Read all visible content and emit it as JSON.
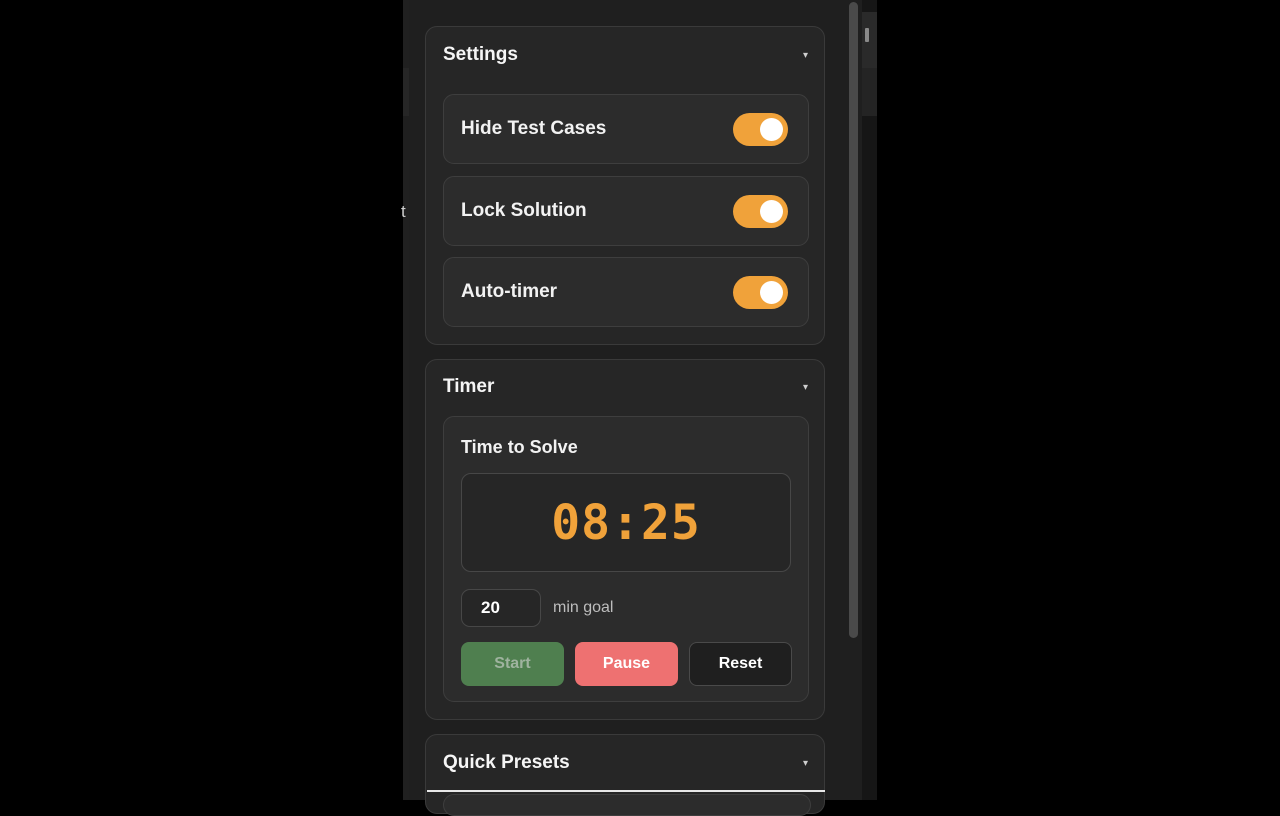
{
  "background": {
    "left_fragment": "t"
  },
  "settings": {
    "title": "Settings",
    "caret": "▾",
    "items": [
      {
        "label": "Hide Test Cases",
        "enabled": true
      },
      {
        "label": "Lock Solution",
        "enabled": true
      },
      {
        "label": "Auto-timer",
        "enabled": true
      }
    ]
  },
  "timer": {
    "title": "Timer",
    "caret": "▾",
    "subtitle": "Time to Solve",
    "display": "08:25",
    "goal_value": "20",
    "goal_label": "min goal",
    "buttons": {
      "start": "Start",
      "pause": "Pause",
      "reset": "Reset"
    }
  },
  "presets": {
    "title": "Quick Presets",
    "caret": "▾"
  },
  "colors": {
    "accent": "#f0a23a",
    "start_button": "#4f7f4f",
    "pause_button": "#ee7171",
    "panel_bg": "#1f1f1f"
  },
  "icons": {
    "section_toggle": "chevron-down-icon"
  }
}
